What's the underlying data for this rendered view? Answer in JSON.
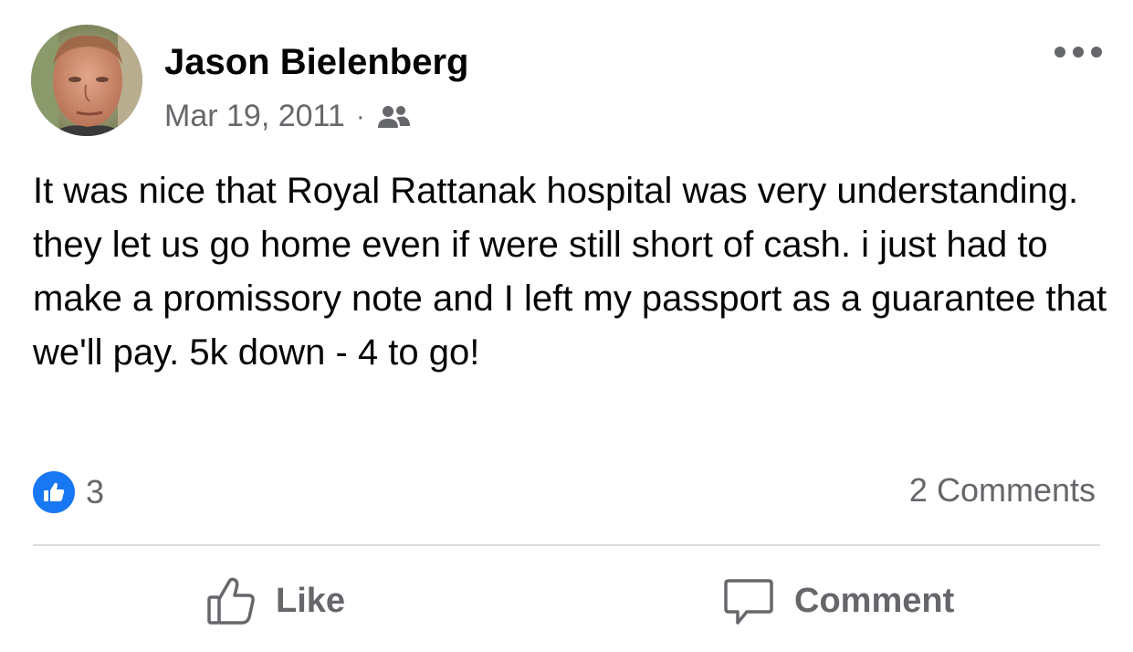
{
  "post": {
    "author": "Jason Bielenberg",
    "date": "Mar 19, 2011",
    "separator": "·",
    "audience_icon": "friends-icon",
    "more_icon": "more-options-icon",
    "text": "It was nice that Royal Rattanak hospital was very understanding. they let us go home even if were still short of cash. i just had to make a promissory note and I left my passport as a guarantee that we'll pay. 5k down - 4 to go!"
  },
  "stats": {
    "reaction_icon": "like-reaction-icon",
    "reaction_count": "3",
    "comments_label": "2 Comments"
  },
  "actions": {
    "like_label": "Like",
    "comment_label": "Comment"
  },
  "colors": {
    "primary_text": "#050505",
    "secondary_text": "#65676b",
    "like_blue": "#1877f2",
    "divider": "#dadde1"
  }
}
